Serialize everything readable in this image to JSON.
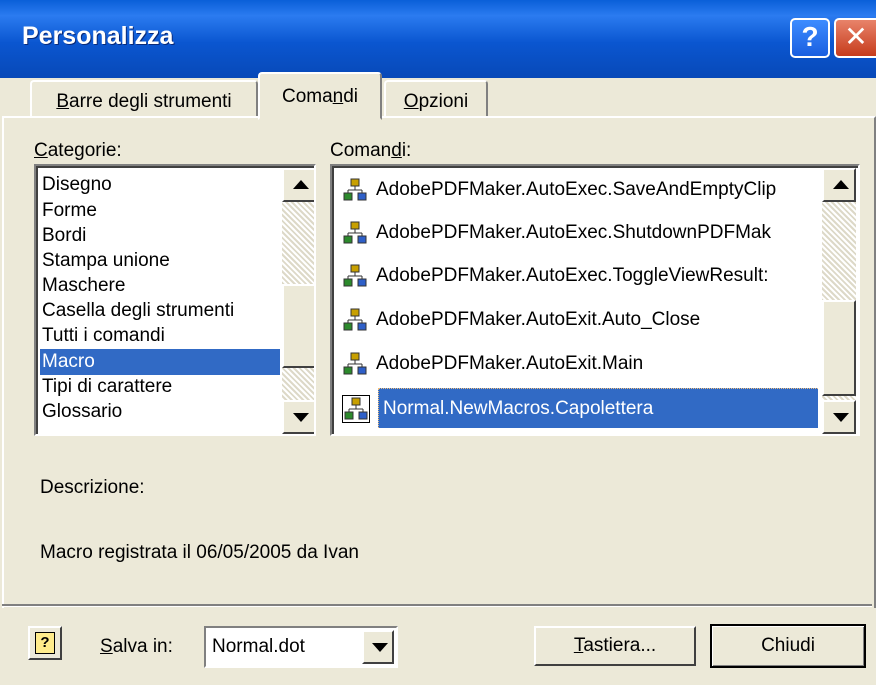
{
  "window": {
    "title": "Personalizza",
    "help_glyph": "?",
    "close_glyph": "✕"
  },
  "tabs": [
    {
      "label_pre": "",
      "label_u": "B",
      "label_post": "arre degli strumenti"
    },
    {
      "label_pre": "Coma",
      "label_u": "n",
      "label_post": "di"
    },
    {
      "label_pre": "",
      "label_u": "O",
      "label_post": "pzioni"
    }
  ],
  "categories": {
    "label_u": "C",
    "label_post": "ategorie:",
    "items": [
      "Disegno",
      "Forme",
      "Bordi",
      "Stampa unione",
      "Maschere",
      "Casella degli strumenti",
      "Tutti i comandi",
      "Macro",
      "Tipi di carattere",
      "Glossario"
    ],
    "selected": "Macro"
  },
  "commands": {
    "label_pre": "Coman",
    "label_u": "d",
    "label_post": "i:",
    "items": [
      "AdobePDFMaker.AutoExec.SaveAndEmptyClip",
      "AdobePDFMaker.AutoExec.ShutdownPDFMak",
      "AdobePDFMaker.AutoExec.ToggleViewResult:",
      "AdobePDFMaker.AutoExit.Auto_Close",
      "AdobePDFMaker.AutoExit.Main",
      "Normal.NewMacros.Capolettera"
    ],
    "selected": "Normal.NewMacros.Capolettera"
  },
  "description": {
    "label": "Descrizione:",
    "text": "Macro registrata il 06/05/2005 da Ivan"
  },
  "bottom": {
    "help_glyph": "?",
    "save_in_u": "S",
    "save_in_post": "alva in:",
    "save_in_value": "Normal.dot",
    "keyboard_u": "T",
    "keyboard_post": "astiera...",
    "close_label": "Chiudi"
  },
  "colors": {
    "selection": "#316ac5",
    "title_bar": "#0a56d0",
    "dialog_bg": "#ece9d8"
  }
}
